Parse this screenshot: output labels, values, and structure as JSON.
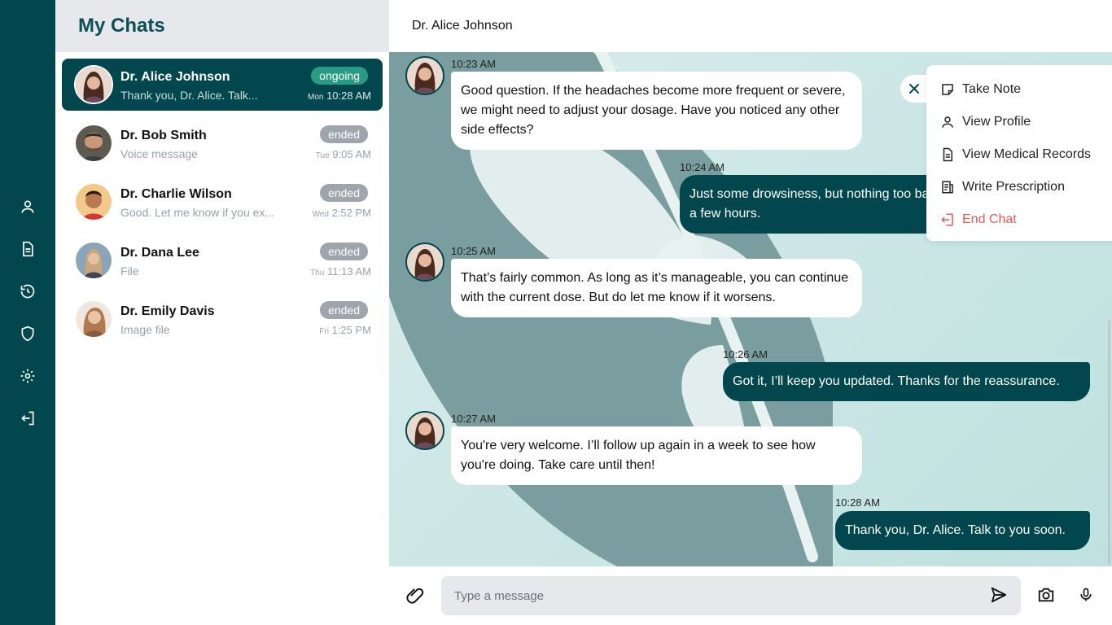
{
  "sidebar": {
    "icons": [
      "user-icon",
      "document-icon",
      "history-icon",
      "shield-icon",
      "settings-icon",
      "logout-icon"
    ]
  },
  "chat_list": {
    "title": "My Chats",
    "items": [
      {
        "name": "Dr. Alice Johnson",
        "preview": "Thank you, Dr. Alice. Talk...",
        "status": "ongoing",
        "day": "Mon",
        "time": "10:28 AM",
        "active": true
      },
      {
        "name": "Dr. Bob Smith",
        "preview": "Voice message",
        "status": "ended",
        "day": "Tue",
        "time": "9:05 AM"
      },
      {
        "name": "Dr. Charlie Wilson",
        "preview": "Good. Let me know if you ex...",
        "status": "ended",
        "day": "Wed",
        "time": "2:52 PM"
      },
      {
        "name": "Dr. Dana Lee",
        "preview": "File",
        "status": "ended",
        "day": "Thu",
        "time": "11:13 AM"
      },
      {
        "name": "Dr. Emily Davis",
        "preview": "Image file",
        "status": "ended",
        "day": "Fri",
        "time": "1:25 PM"
      }
    ]
  },
  "conversation": {
    "title": "Dr. Alice Johnson",
    "messages": [
      {
        "from": "doctor",
        "time": "10:23 AM",
        "text": "Good question. If the headaches become more frequent or severe, we might need to adjust your dosage. Have you noticed any other side effects?"
      },
      {
        "from": "me",
        "time": "10:24 AM",
        "text": "Just some drowsiness, but nothing too bad. It usually goes away after a few hours."
      },
      {
        "from": "doctor",
        "time": "10:25 AM",
        "text": "That’s fairly common. As long as it’s manageable, you can continue with the current dose. But do let me know if it worsens."
      },
      {
        "from": "me",
        "time": "10:26 AM",
        "text": "Got it, I’ll keep you updated. Thanks for the reassurance."
      },
      {
        "from": "doctor",
        "time": "10:27 AM",
        "text": "You're very welcome. I’ll follow up again in a week to see how you're doing. Take care until then!"
      },
      {
        "from": "me",
        "time": "10:28 AM",
        "text": "Thank you, Dr. Alice. Talk to you soon."
      }
    ]
  },
  "menu": {
    "close_icon": "close-icon",
    "items": [
      {
        "label": "Take Note",
        "icon": "note-icon"
      },
      {
        "label": "View Profile",
        "icon": "user-icon"
      },
      {
        "label": "View Medical Records",
        "icon": "document-icon"
      },
      {
        "label": "Write Prescription",
        "icon": "prescription-icon"
      },
      {
        "label": "End Chat",
        "icon": "exit-icon",
        "color": "#e45a57"
      }
    ]
  },
  "composer": {
    "placeholder": "Type a message",
    "value": ""
  },
  "colors": {
    "primary": "#02474d",
    "ongoing_badge": "#2a9b83",
    "ended_badge": "#9ea5ad",
    "danger": "#e45a57"
  }
}
